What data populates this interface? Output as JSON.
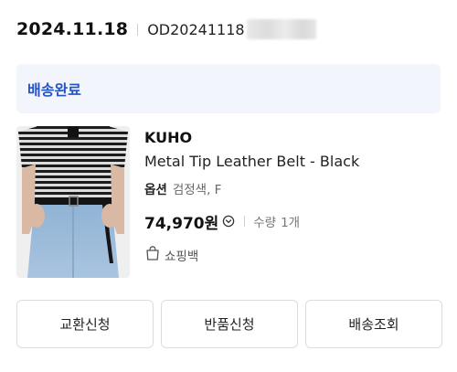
{
  "order": {
    "date": "2024.11.18",
    "number_visible": "OD20241118"
  },
  "status": {
    "label": "배송완료",
    "color": "#2453c7"
  },
  "product": {
    "brand": "KUHO",
    "name": "Metal Tip Leather Belt - Black",
    "option_label": "옵션",
    "option_value": "검정색, F",
    "price": "74,970원",
    "quantity_label": "수량",
    "quantity_value": "1개",
    "bag_label": "쇼핑백",
    "image_icon": "product-photo-striped-knit-jeans-belt",
    "price_info_icon": "info-circle-icon",
    "bag_icon": "shopping-bag-icon"
  },
  "actions": [
    {
      "label": "교환신청"
    },
    {
      "label": "반품신청"
    },
    {
      "label": "배송조회"
    }
  ]
}
